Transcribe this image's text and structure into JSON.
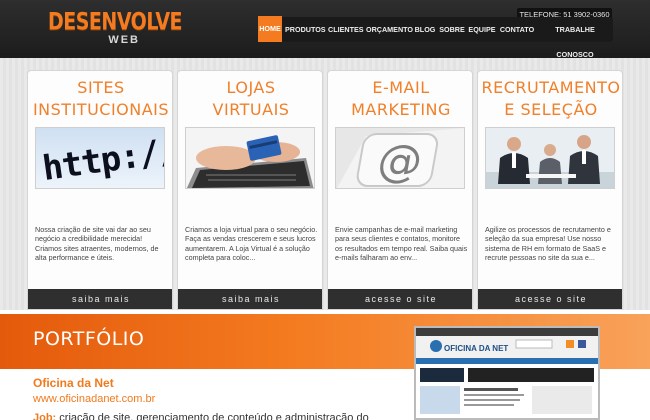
{
  "header": {
    "logo_main": "DESENVOLVE",
    "logo_sub": "WEB",
    "phone": "TELEFONE: 51 3902-0360",
    "nav": [
      {
        "label": "HOME",
        "active": true
      },
      {
        "label": "PRODUTOS",
        "active": false
      },
      {
        "label": "CLIENTES",
        "active": false
      },
      {
        "label": "ORÇAMENTO",
        "active": false
      },
      {
        "label": "BLOG",
        "active": false
      },
      {
        "label": "SOBRE",
        "active": false
      },
      {
        "label": "EQUIPE",
        "active": false
      },
      {
        "label": "CONTATO",
        "active": false
      },
      {
        "label": "TRABALHE CONOSCO",
        "active": false
      }
    ]
  },
  "cards": [
    {
      "title": "SITES\nINSTITUCIONAIS",
      "image": "http-url-closeup",
      "text": "Nossa criação de site vai dar ao seu negócio a credibilidade merecida! Criamos sites atraentes, modernos, de alta performance e úteis.",
      "button": "saiba mais"
    },
    {
      "title": "LOJAS\nVIRTUAIS",
      "image": "hands-credit-card-laptop",
      "text": "Criamos a loja virtual para o seu negócio. Faça as vendas crescerem e seus lucros aumentarem. A Loja Virtual é a solução completa para coloc...",
      "button": "saiba mais"
    },
    {
      "title": "E-MAIL\nMARKETING",
      "image": "at-sign-key",
      "text": "Envie campanhas de e-mail marketing para seus clientes e contatos, monitore os resultados em tempo real. Saiba quais e-mails falharam ao env...",
      "button": "acesse o site"
    },
    {
      "title": "RECRUTAMENTO\nE SELEÇÃO",
      "image": "business-people-meeting",
      "text": "Agilize os processos de recrutamento e seleção da sua empresa! Use nosso sistema de RH em formato de SaaS e recrute pessoas no site da sua e...",
      "button": "acesse o site"
    }
  ],
  "portfolio": {
    "title": "PORTFÓLIO",
    "name": "Oficina da Net",
    "url": "www.oficinadanet.com.br",
    "job_label": "Job:",
    "job_text": " criação de site, gerenciamento de conteúdo e administração do",
    "screenshot_site_name": "OFICINA DA NET"
  },
  "colors": {
    "accent": "#f47b20",
    "header_bg": "#222222",
    "button_bg": "#2f2f2f"
  }
}
